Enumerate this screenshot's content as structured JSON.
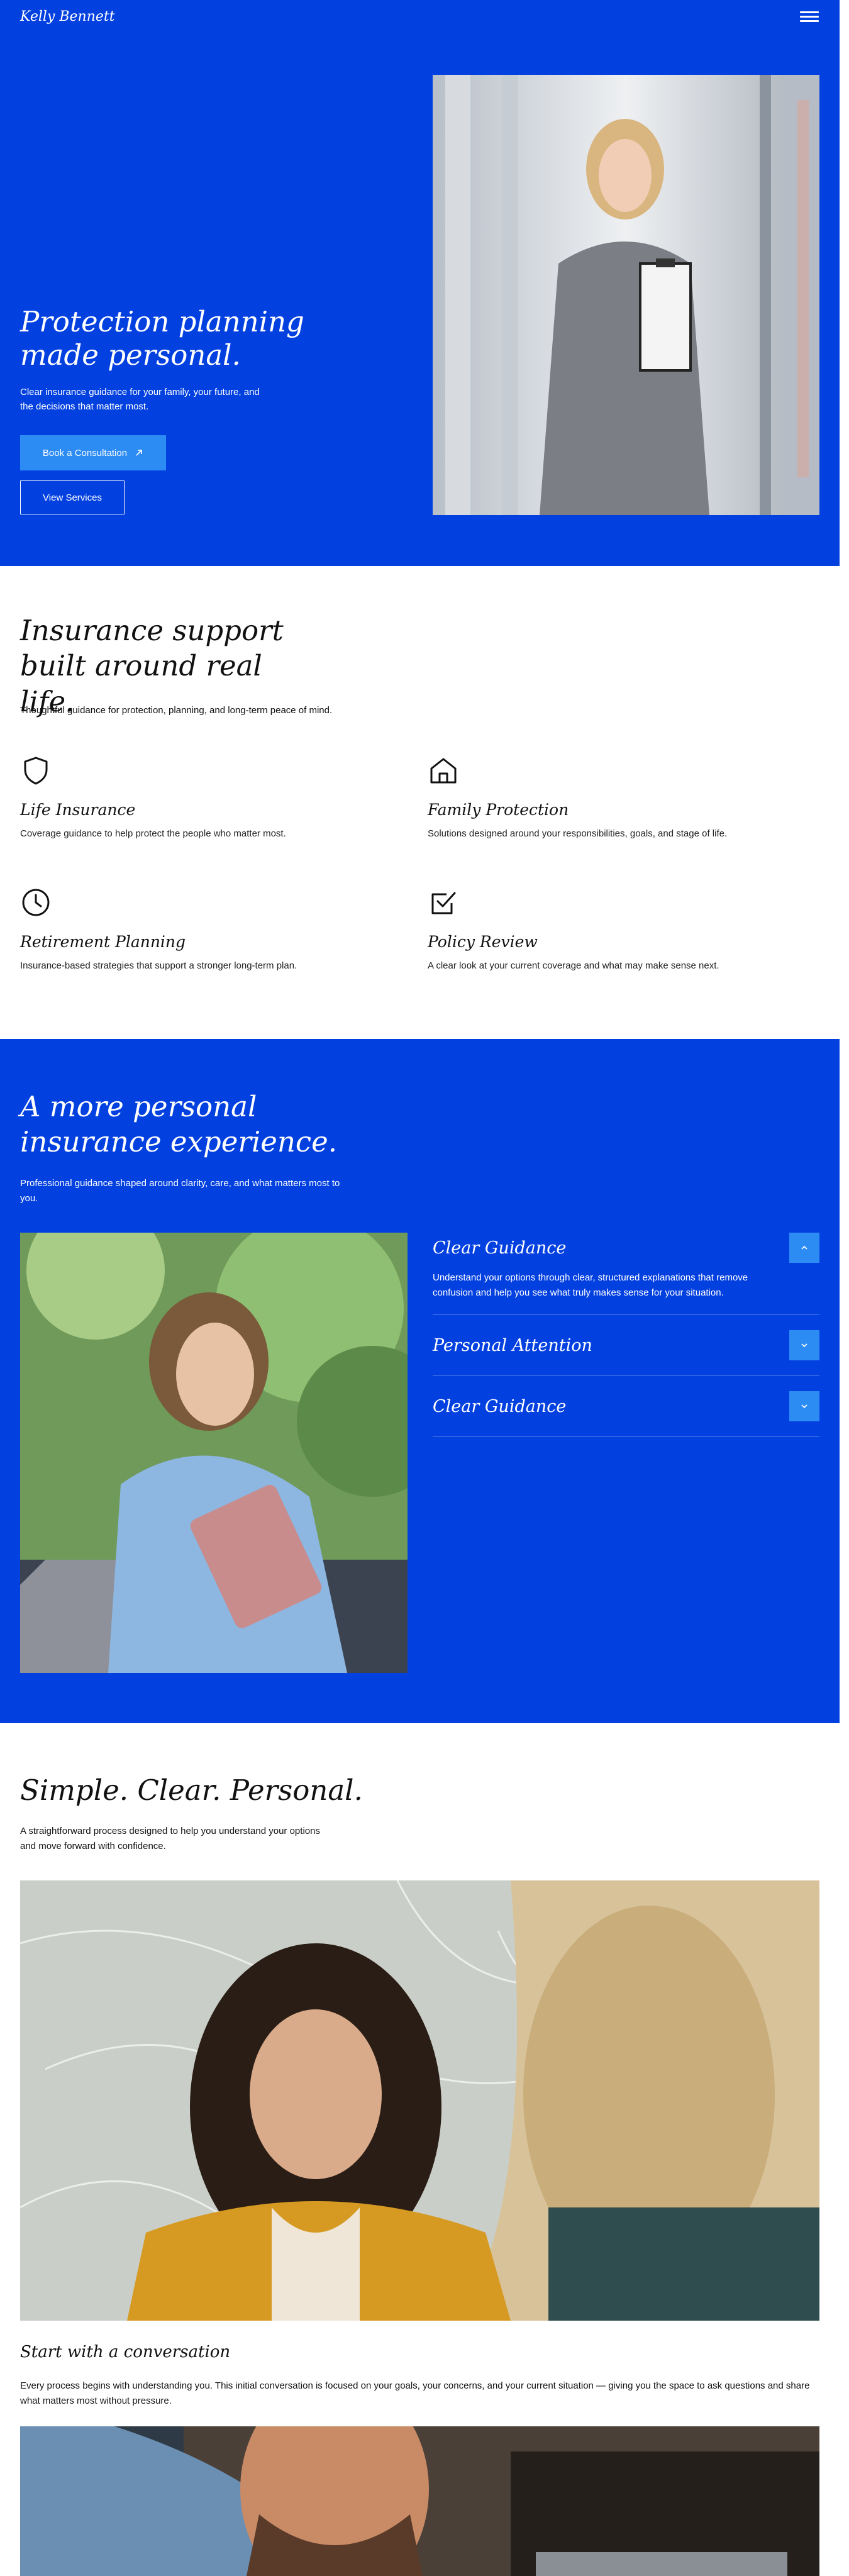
{
  "header": {
    "brand": "Kelly Bennett",
    "menu_icon": "hamburger-menu-icon"
  },
  "hero": {
    "title": "Protection planning made personal.",
    "subtitle": "Clear insurance guidance for your family, your future, and the decisions that matter most.",
    "primary_cta": "Book a Consultation",
    "primary_cta_icon": "arrow-up-right-icon",
    "secondary_cta": "View Services",
    "colors": {
      "background": "#0340e0",
      "button": "#2d8cf4"
    }
  },
  "services": {
    "title": "Insurance support built around real life.",
    "subtitle": "Thoughtful guidance for protection, planning, and long-term peace of mind.",
    "items": [
      {
        "icon": "shield-icon",
        "name": "Life Insurance",
        "description": "Coverage guidance to help protect the people who matter most."
      },
      {
        "icon": "home-icon",
        "name": "Family Protection",
        "description": "Solutions designed around your responsibilities, goals, and stage of life."
      },
      {
        "icon": "clock-icon",
        "name": "Retirement Planning",
        "description": "Insurance-based strategies that support a stronger long-term plan."
      },
      {
        "icon": "checkbox-icon",
        "name": "Policy Review",
        "description": "A clear look at your current coverage and what may make sense next."
      }
    ]
  },
  "experience": {
    "title": "A more personal insurance experience.",
    "subtitle": "Professional guidance shaped around clarity, care, and what matters most to you.",
    "accordion": [
      {
        "name": "Clear Guidance",
        "expanded": true,
        "icon": "chevron-up-icon",
        "body": "Understand your options through clear, structured explanations that remove confusion and help you see what truly makes sense for your situation."
      },
      {
        "name": "Personal Attention",
        "expanded": false,
        "icon": "chevron-down-icon"
      },
      {
        "name": "Clear Guidance",
        "expanded": false,
        "icon": "chevron-down-icon"
      }
    ]
  },
  "process": {
    "title": "Simple. Clear. Personal.",
    "subtitle": "A straightforward process designed to help you understand your options and move forward with confidence.",
    "step_title": "Start with a conversation",
    "step_description": "Every process begins with understanding you. This initial conversation is focused on your goals, your concerns, and your current situation — giving you the space to ask questions and share what matters most without pressure."
  }
}
